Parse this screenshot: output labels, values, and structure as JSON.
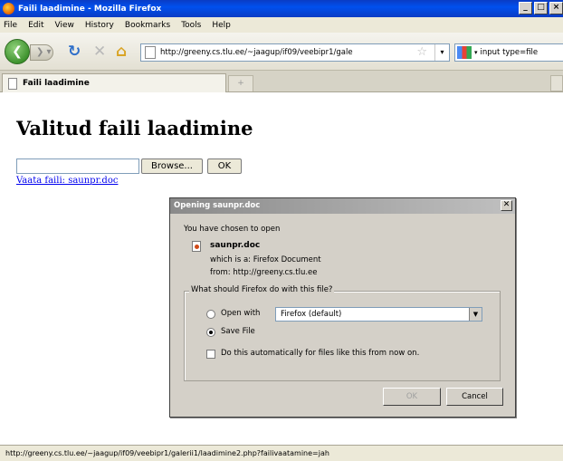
{
  "window": {
    "title": "Faili laadimine - Mozilla Firefox",
    "controls": [
      "_",
      "□",
      "×"
    ]
  },
  "menu": [
    "File",
    "Edit",
    "View",
    "History",
    "Bookmarks",
    "Tools",
    "Help"
  ],
  "nav": {
    "url": "http://greeny.cs.tlu.ee/~jaagup/if09/veebipr1/gale",
    "search": "input type=file",
    "icons": [
      "back-icon",
      "forward-icon",
      "reload-icon",
      "stop-icon",
      "home-icon",
      "bookmark-star-icon",
      "search-engine-icon"
    ]
  },
  "tabs": [
    {
      "label": "Faili laadimine"
    }
  ],
  "page": {
    "heading": "Valitud faili laadimine",
    "browse_label": "Browse...",
    "ok_label": "OK",
    "link": "Vaata faili: saunpr.doc"
  },
  "dialog": {
    "title": "Opening saunpr.doc",
    "intro": "You have chosen to open",
    "filename": "saunpr.doc",
    "which_is": "which is a:  Firefox Document",
    "from": "from:  http://greeny.cs.tlu.ee",
    "question": "What should Firefox do with this file?",
    "open_with_label": "Open with",
    "open_with_value": "Firefox (default)",
    "save_file_label": "Save File",
    "auto_label": "Do this automatically for files like this from now on.",
    "ok_label": "OK",
    "cancel_label": "Cancel",
    "selected_option": "save_file",
    "auto_checked": false
  },
  "status": "http://greeny.cs.tlu.ee/~jaagup/if09/veebipr1/galerii1/laadimine2.php?failivaatamine=jah"
}
